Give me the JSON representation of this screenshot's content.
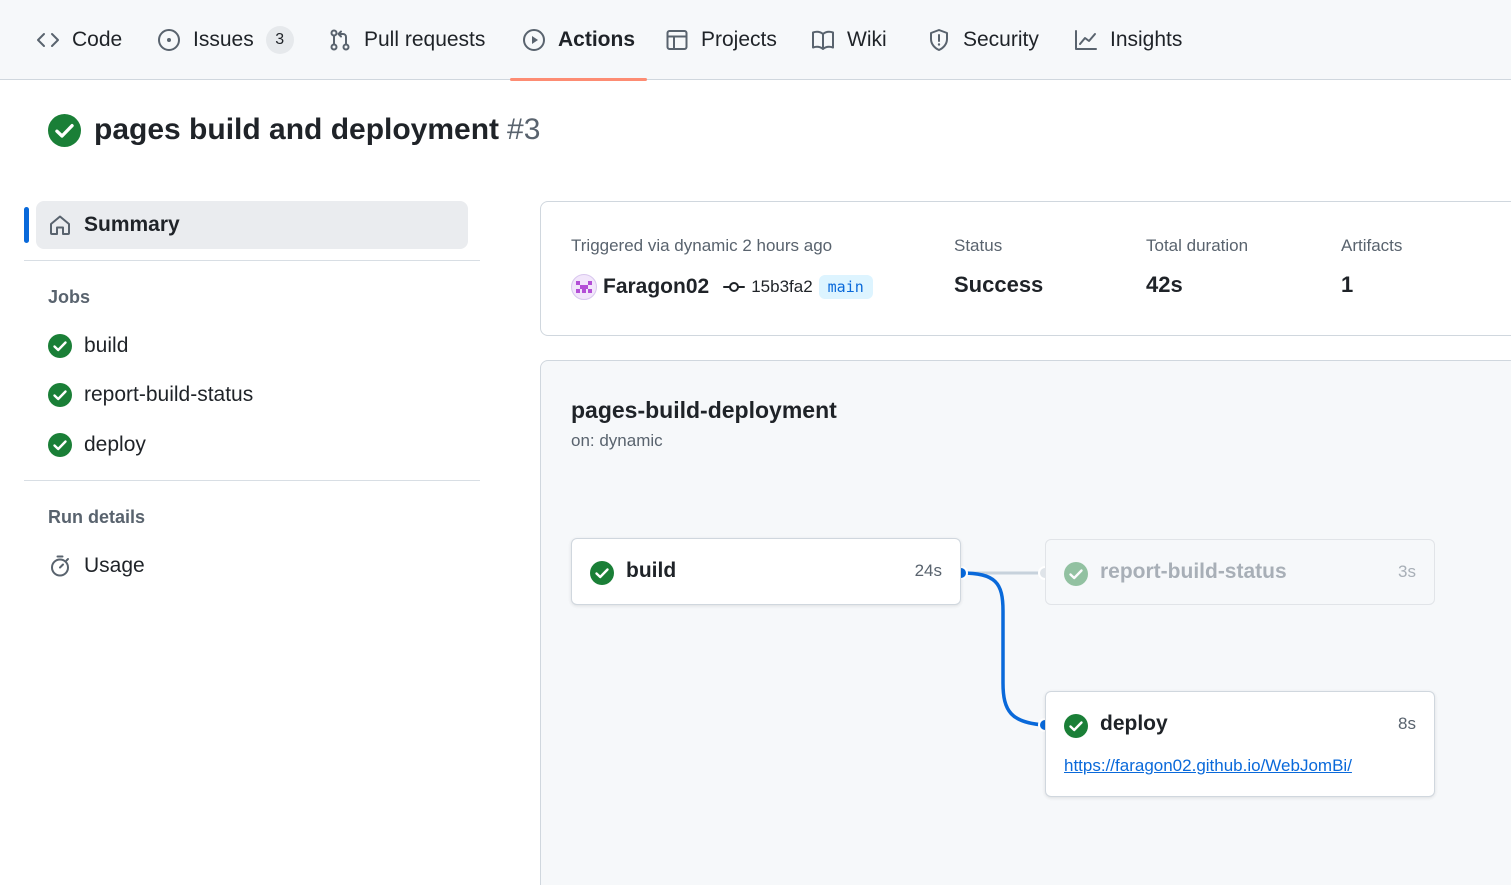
{
  "nav": {
    "code": "Code",
    "issues": "Issues",
    "issues_count": "3",
    "pull_requests": "Pull requests",
    "actions": "Actions",
    "projects": "Projects",
    "wiki": "Wiki",
    "security": "Security",
    "insights": "Insights",
    "active_tab": "Actions",
    "active_underline_color": "#fd8c73"
  },
  "run": {
    "title": "pages build and deployment",
    "number": "#3",
    "status_icon": "check-circle-fill-icon"
  },
  "sidebar": {
    "summary_label": "Summary",
    "jobs_heading": "Jobs",
    "jobs": [
      {
        "label": "build"
      },
      {
        "label": "report-build-status"
      },
      {
        "label": "deploy"
      }
    ],
    "run_details_heading": "Run details",
    "usage_label": "Usage"
  },
  "summary": {
    "triggered_text": "Triggered via dynamic 2 hours ago",
    "actor": "Faragon02",
    "commit_sha": "15b3fa2",
    "branch": "main",
    "status_label": "Status",
    "status_value": "Success",
    "duration_label": "Total duration",
    "duration_value": "42s",
    "artifacts_label": "Artifacts",
    "artifacts_value": "1"
  },
  "workflow": {
    "name": "pages-build-deployment",
    "trigger": "on: dynamic",
    "jobs": {
      "build": {
        "name": "build",
        "duration": "24s"
      },
      "report": {
        "name": "report-build-status",
        "duration": "3s"
      },
      "deploy": {
        "name": "deploy",
        "duration": "8s",
        "url": "https://faragon02.github.io/WebJomBi/"
      }
    }
  },
  "colors": {
    "success": "#1a7f37",
    "accent": "#0969da"
  }
}
